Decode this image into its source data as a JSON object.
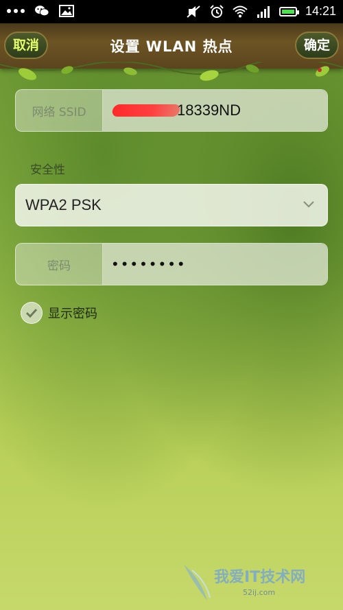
{
  "status_bar": {
    "time": "14:21",
    "icons": [
      "more-dots-icon",
      "wechat-icon",
      "image-icon",
      "mute-icon",
      "alarm-icon",
      "wifi-icon",
      "signal-icon",
      "battery-icon"
    ]
  },
  "header": {
    "title": "设置 WLAN 热点",
    "cancel_label": "取消",
    "confirm_label": "确定"
  },
  "form": {
    "ssid": {
      "label": "网络 SSID",
      "value": "18339ND"
    },
    "security": {
      "label": "安全性",
      "selected": "WPA2 PSK"
    },
    "password": {
      "label": "密码",
      "value": "••••••••"
    },
    "show_password": {
      "label": "显示密码",
      "checked": true
    }
  },
  "watermark": {
    "text": "我爱IT技术网",
    "sub": "52ij.com"
  },
  "colors": {
    "header_bg": "#5b451e",
    "accent_text": "#e4ff6a",
    "background_top": "#6e9a34",
    "background_bottom": "#c6d86b",
    "redaction": "#ff2a2a"
  }
}
